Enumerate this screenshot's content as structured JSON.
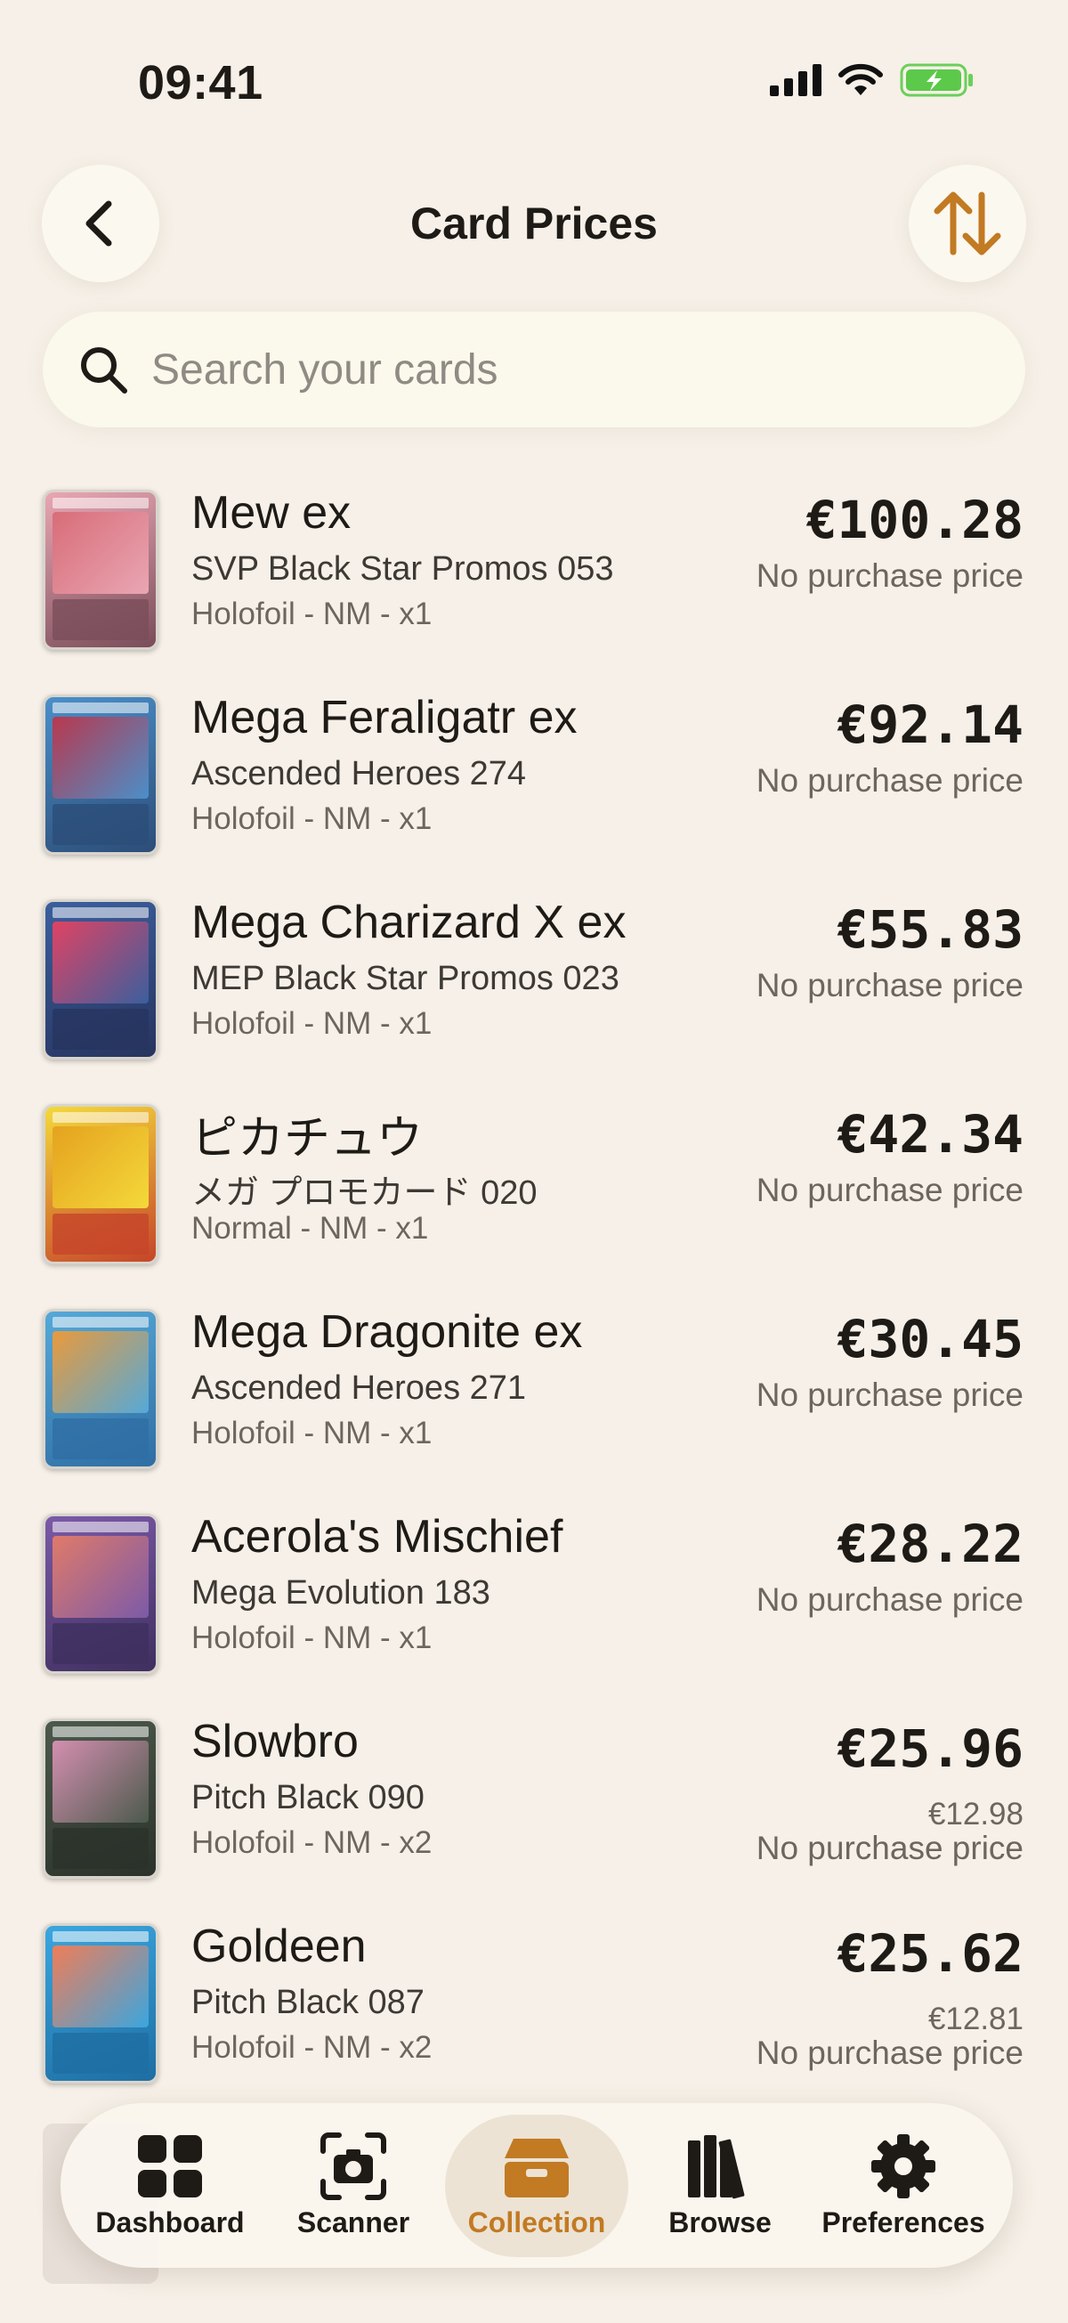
{
  "status_bar": {
    "time": "09:41"
  },
  "header": {
    "title": "Card Prices",
    "back_icon": "chevron-left-icon",
    "sort_icon": "sort-arrows-icon",
    "accent_color": "#c27a23"
  },
  "search": {
    "placeholder": "Search your cards",
    "value": ""
  },
  "cards": [
    {
      "name": "Mew ex",
      "set": "SVP Black Star Promos 053",
      "detail": "Holofoil - NM - x1",
      "price": "€100.28",
      "paid": "",
      "purchase_note": "No purchase price",
      "thumb_colors": [
        "#e9a6b3",
        "#d86d78",
        "#7a4d5a"
      ]
    },
    {
      "name": "Mega Feraligatr ex",
      "set": "Ascended Heroes 274",
      "detail": "Holofoil - NM - x1",
      "price": "€92.14",
      "paid": "",
      "purchase_note": "No purchase price",
      "thumb_colors": [
        "#4a8fc9",
        "#b9384e",
        "#2c4d78"
      ]
    },
    {
      "name": "Mega Charizard X ex",
      "set": "MEP Black Star Promos 023",
      "detail": "Holofoil - NM - x1",
      "price": "€55.83",
      "paid": "",
      "purchase_note": "No purchase price",
      "thumb_colors": [
        "#3b5f9e",
        "#e04363",
        "#27345f"
      ]
    },
    {
      "name": "ピカチュウ",
      "set": "メガ プロモカード 020",
      "detail": "Normal - NM - x1",
      "price": "€42.34",
      "paid": "",
      "purchase_note": "No purchase price",
      "thumb_colors": [
        "#f4d93a",
        "#e5a21f",
        "#c6452a"
      ]
    },
    {
      "name": "Mega Dragonite ex",
      "set": "Ascended Heroes 271",
      "detail": "Holofoil - NM - x1",
      "price": "€30.45",
      "paid": "",
      "purchase_note": "No purchase price",
      "thumb_colors": [
        "#55a9d8",
        "#e99a3c",
        "#2f6ea4"
      ]
    },
    {
      "name": "Acerola's Mischief",
      "set": "Mega Evolution 183",
      "detail": "Holofoil - NM - x1",
      "price": "€28.22",
      "paid": "",
      "purchase_note": "No purchase price",
      "thumb_colors": [
        "#7b5aa8",
        "#e07a6a",
        "#3f2f5f"
      ]
    },
    {
      "name": "Slowbro",
      "set": "Pitch Black 090",
      "detail": "Holofoil - NM - x2",
      "price": "€25.96",
      "paid": "€12.98",
      "purchase_note": "No purchase price",
      "thumb_colors": [
        "#4c5a4c",
        "#d48fb0",
        "#2b322b"
      ]
    },
    {
      "name": "Goldeen",
      "set": "Pitch Black 087",
      "detail": "Holofoil - NM - x2",
      "price": "€25.62",
      "paid": "€12.81",
      "purchase_note": "No purchase price",
      "thumb_colors": [
        "#3aa6df",
        "#f07d58",
        "#1e6ea3"
      ]
    }
  ],
  "tabs": [
    {
      "label": "Dashboard",
      "icon": "grid-icon",
      "active": false
    },
    {
      "label": "Scanner",
      "icon": "camera-icon",
      "active": false
    },
    {
      "label": "Collection",
      "icon": "box-icon",
      "active": true
    },
    {
      "label": "Browse",
      "icon": "books-icon",
      "active": false
    },
    {
      "label": "Preferences",
      "icon": "gear-icon",
      "active": false
    }
  ]
}
